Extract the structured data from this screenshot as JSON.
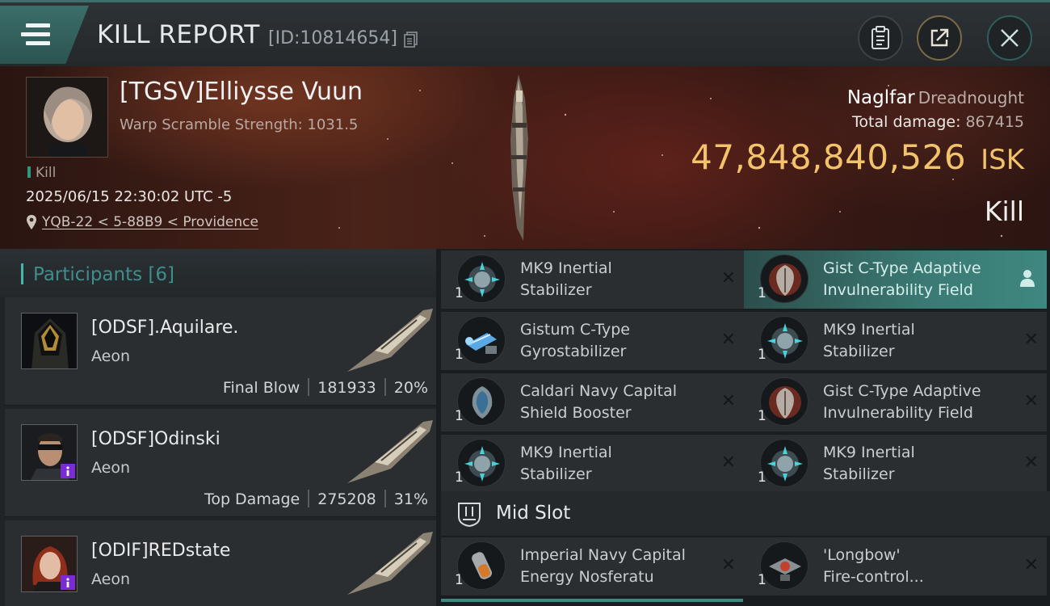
{
  "header": {
    "title": "KILL REPORT",
    "report_id": "[ID:10814654]",
    "icons": [
      "menu-icon",
      "copy-icon",
      "clipboard-icon",
      "share-icon",
      "close-icon"
    ]
  },
  "victim": {
    "name": "[TGSV]Elliysse Vuun",
    "stat": "Warp Scramble Strength: 1031.5",
    "tag": "Kill",
    "timestamp": "2025/06/15 22:30:02 UTC -5",
    "location": "YQB-22 < 5-88B9 < Providence",
    "ship_name": "Naglfar",
    "ship_class": "Dreadnought",
    "total_damage_label": "Total damage:",
    "total_damage": "867415",
    "isk_value": "47,848,840,526",
    "isk_unit": "ISK",
    "result": "Kill"
  },
  "participants": {
    "title": "Participants [6]",
    "rows": [
      {
        "name": "[ODSF].Aquilare.",
        "ship": "Aeon",
        "role": "Final Blow",
        "damage": "181933",
        "percent": "20%"
      },
      {
        "name": "[ODSF]Odinski",
        "ship": "Aeon",
        "role": "Top Damage",
        "damage": "275208",
        "percent": "31%"
      },
      {
        "name": "[ODIF]REDstate",
        "ship": "Aeon",
        "role": "",
        "damage": "",
        "percent": ""
      }
    ]
  },
  "modules": {
    "items": [
      {
        "qty": "1",
        "line1": "MK9 Inertial",
        "line2": "Stabilizer",
        "icon": "inertial-stabilizer-icon"
      },
      {
        "qty": "1",
        "line1": "Gist C-Type Adaptive",
        "line2": "Invulnerability Field",
        "icon": "invulnerability-field-icon"
      },
      {
        "qty": "1",
        "line1": "Gistum C-Type",
        "line2": "Gyrostabilizer",
        "icon": "gyrostabilizer-icon"
      },
      {
        "qty": "1",
        "line1": "MK9 Inertial",
        "line2": "Stabilizer",
        "icon": "inertial-stabilizer-icon"
      },
      {
        "qty": "1",
        "line1": "Caldari Navy Capital",
        "line2": "Shield Booster",
        "icon": "shield-booster-icon"
      },
      {
        "qty": "1",
        "line1": "Gist C-Type Adaptive",
        "line2": "Invulnerability Field",
        "icon": "invulnerability-field-icon"
      },
      {
        "qty": "1",
        "line1": "MK9 Inertial",
        "line2": "Stabilizer",
        "icon": "inertial-stabilizer-icon"
      },
      {
        "qty": "1",
        "line1": "MK9 Inertial",
        "line2": "Stabilizer",
        "icon": "inertial-stabilizer-icon"
      }
    ],
    "mid_slot_title": "Mid Slot",
    "mid_items": [
      {
        "qty": "1",
        "line1": "Imperial Navy Capital",
        "line2": "Energy Nosferatu",
        "icon": "energy-nosferatu-icon"
      },
      {
        "qty": "1",
        "line1": "'Longbow'",
        "line2": "Fire-control...",
        "icon": "fire-control-icon"
      }
    ],
    "remove_glyph": "✕"
  },
  "colors": {
    "accent": "#3f8780",
    "isk_gold": "#f2c36a",
    "role_badge": "#7a2bd6"
  }
}
